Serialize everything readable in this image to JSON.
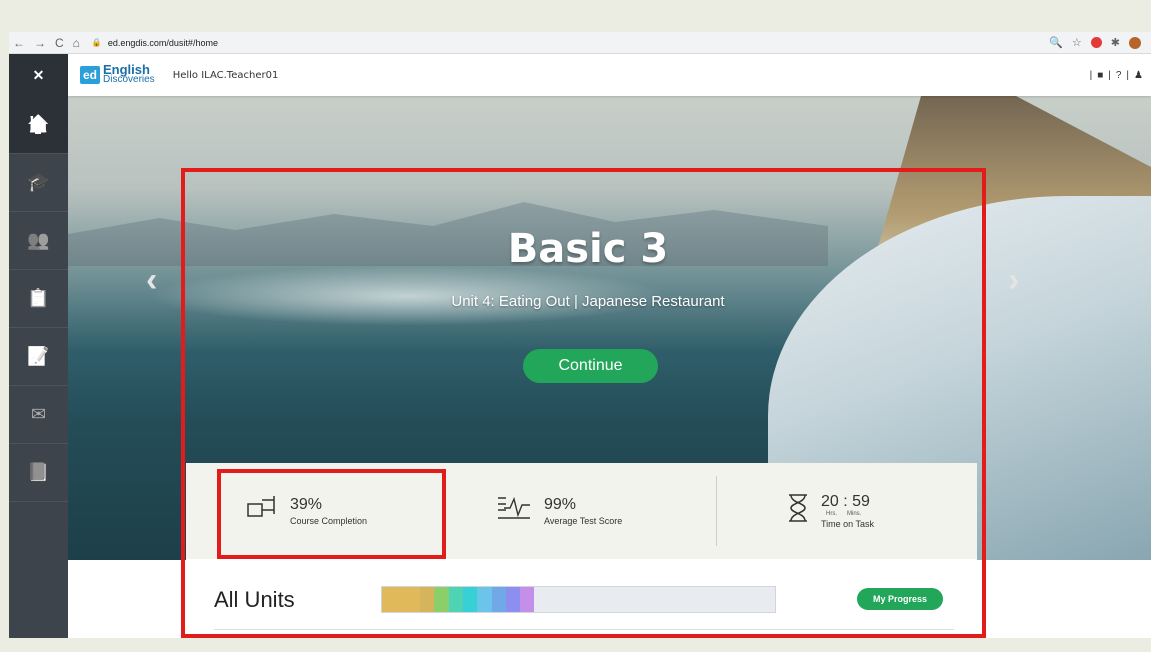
{
  "browser": {
    "url": "ed.engdis.com/dusit#/home",
    "nav_back": "←",
    "nav_forward": "→",
    "nav_reload": "C",
    "nav_home": "⌂",
    "zoom_icon": "🔍",
    "star_icon": "☆",
    "puzzle_icon": "✱"
  },
  "sidebar": {
    "close_label": "✕",
    "items": [
      {
        "icon": "home-icon",
        "glyph": "🏠",
        "active": true
      },
      {
        "icon": "graduation-cap-icon",
        "glyph": "🎓"
      },
      {
        "icon": "group-icon",
        "glyph": "👥"
      },
      {
        "icon": "clipboard-icon",
        "glyph": "📋"
      },
      {
        "icon": "assignment-icon",
        "glyph": "📝"
      },
      {
        "icon": "mail-icon",
        "glyph": "✉"
      },
      {
        "icon": "book-icon",
        "glyph": "📘"
      }
    ]
  },
  "header": {
    "logo_box": "ed",
    "logo_word1": "English",
    "logo_word2": "Discoveries",
    "greeting": "Hello ILAC.Teacher01",
    "right_items": [
      "|",
      "■",
      "|",
      "?",
      "|",
      "♟"
    ]
  },
  "hero": {
    "title": "Basic 3",
    "subtitle": "Unit 4: Eating Out | Japanese Restaurant",
    "continue_label": "Continue",
    "prev_arrow": "‹",
    "next_arrow": "›"
  },
  "stats": {
    "completion_value": "39%",
    "completion_label": "Course Completion",
    "score_value": "99%",
    "score_label": "Average Test Score",
    "time_value": "20 : 59",
    "time_hrs": "Hrs.",
    "time_mins": "Mins.",
    "time_label": "Time on Task"
  },
  "units": {
    "label": "All Units",
    "progress_button": "My Progress",
    "segments": [
      "#e0b95a",
      "#d6b45c",
      "#8ccf6a",
      "#4ed4b5",
      "#36d0d5",
      "#6cc4ea",
      "#70a8e8",
      "#8c8ff0",
      "#c38fe8"
    ],
    "progress_fraction": 0.39
  }
}
